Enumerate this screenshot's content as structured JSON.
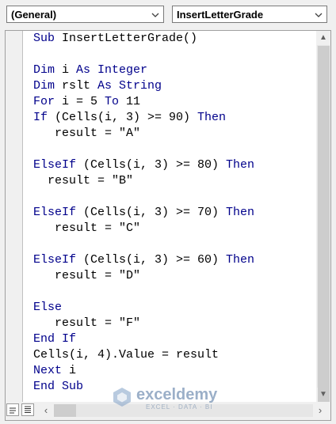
{
  "header": {
    "object_combo": "(General)",
    "procedure_combo": "InsertLetterGrade"
  },
  "code_lines": [
    "Sub InsertLetterGrade()",
    "",
    "Dim i As Integer",
    "Dim rslt As String",
    "For i = 5 To 11",
    "If (Cells(i, 3) >= 90) Then",
    "   result = \"A\"",
    "",
    "ElseIf (Cells(i, 3) >= 80) Then",
    "  result = \"B\"",
    "",
    "ElseIf (Cells(i, 3) >= 70) Then",
    "   result = \"C\"",
    "",
    "ElseIf (Cells(i, 3) >= 60) Then",
    "   result = \"D\"",
    "",
    "Else",
    "   result = \"F\"",
    "End If",
    "Cells(i, 4).Value = result",
    "Next i",
    "End Sub"
  ],
  "watermark": {
    "name": "exceldemy",
    "tagline": "EXCEL · DATA · BI"
  },
  "colors": {
    "keyword": "#00008b",
    "code_text": "#000000",
    "editor_bg": "#ffffff",
    "chrome_bg": "#f0f0f0"
  },
  "icons": {
    "combo_arrow": "chevron-down-icon",
    "procedure_view": "procedure-view-icon",
    "full_module_view": "full-module-view-icon",
    "scroll_up": "scroll-up-arrow-icon",
    "scroll_down": "scroll-down-arrow-icon",
    "scroll_left": "scroll-left-arrow-icon",
    "scroll_right": "scroll-right-arrow-icon",
    "watermark_logo": "exceldemy-logo-icon"
  }
}
